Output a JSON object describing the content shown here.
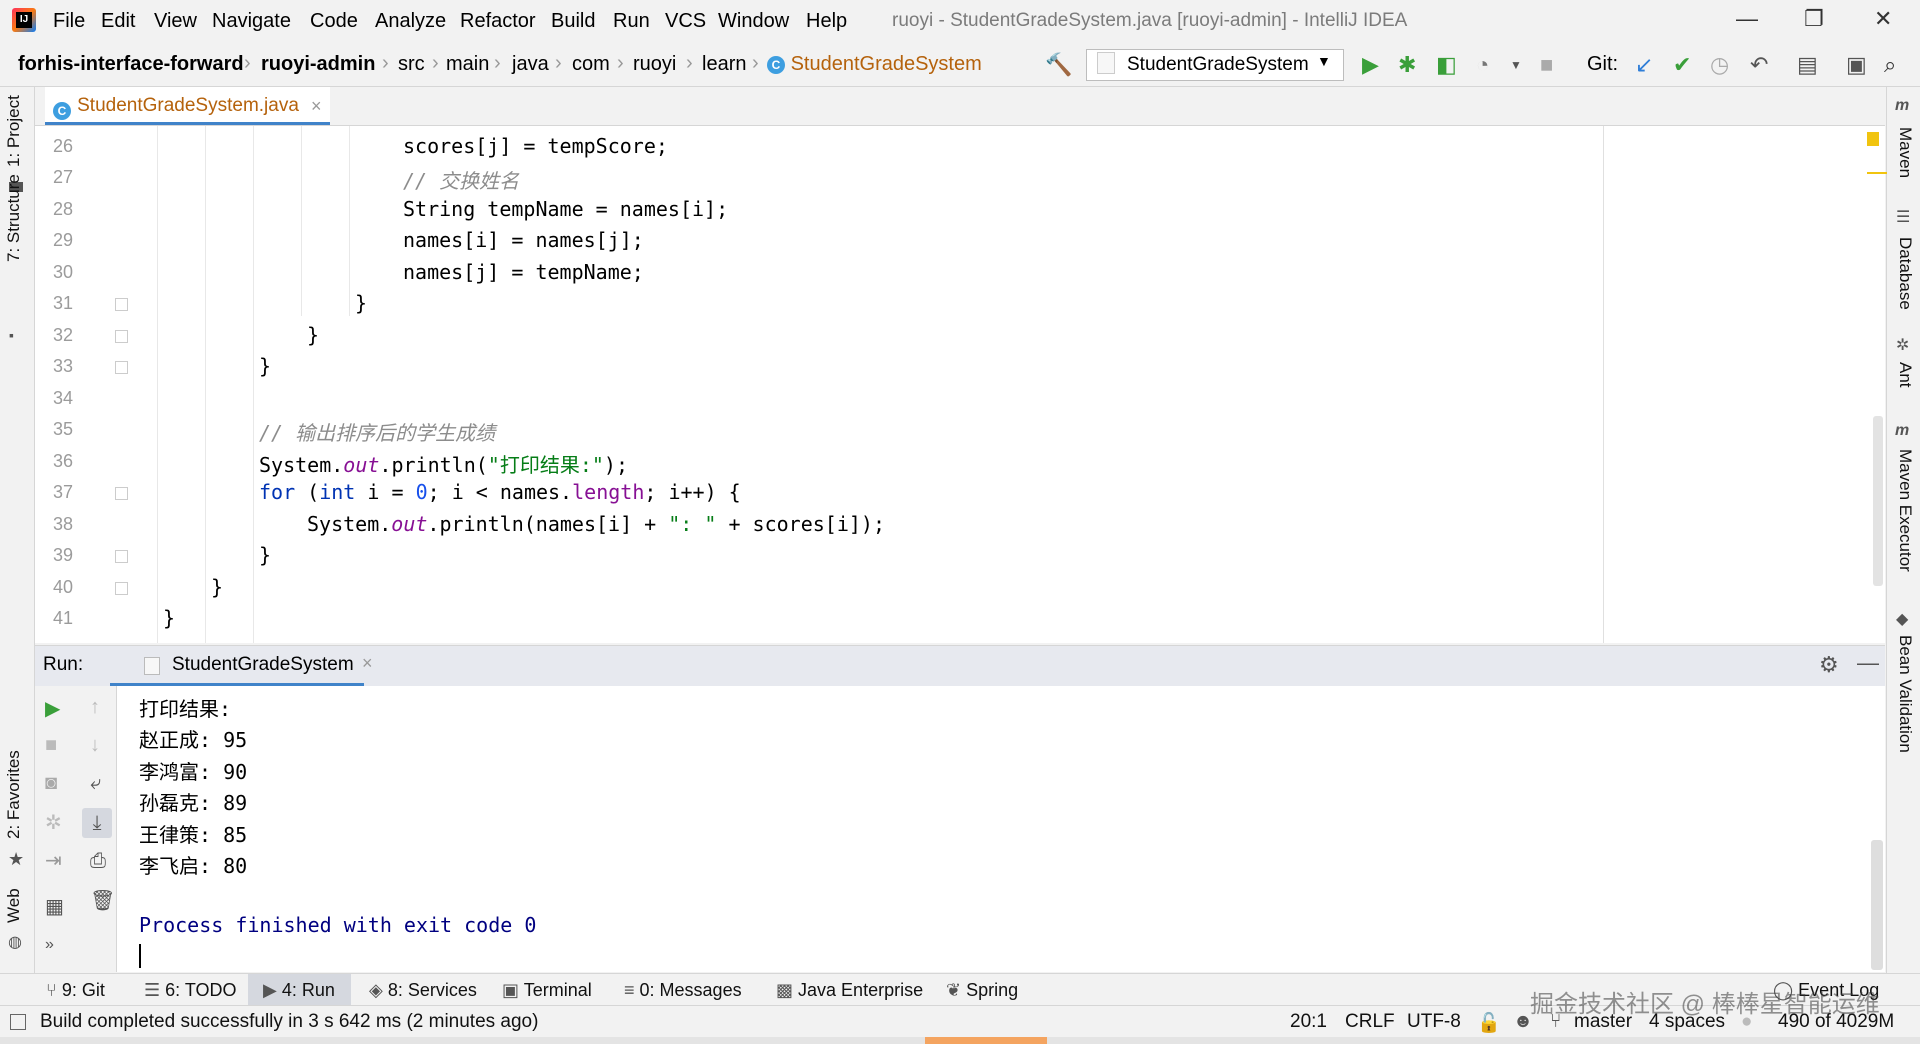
{
  "menubar": {
    "logo_text": "IJ",
    "items": [
      "File",
      "Edit",
      "View",
      "Navigate",
      "Code",
      "Analyze",
      "Refactor",
      "Build",
      "Run",
      "VCS",
      "Window",
      "Help"
    ],
    "window_title": "ruoyi - StudentGradeSystem.java [ruoyi-admin] - IntelliJ IDEA",
    "minimize": "—",
    "restore": "❐",
    "close": "✕"
  },
  "navbar": {
    "crumbs": [
      "forhis-interface-forward",
      "ruoyi-admin",
      "src",
      "main",
      "java",
      "com",
      "ruoyi",
      "learn",
      "StudentGradeSystem"
    ],
    "run_config": "StudentGradeSystem",
    "git_label": "Git:"
  },
  "left_strip": {
    "project": "1: Project",
    "structure": "7: Structure",
    "favorites": "2: Favorites",
    "web": "Web"
  },
  "right_strip": {
    "maven": "Maven",
    "database": "Database",
    "ant": "Ant",
    "maven_executor": "Maven Executor",
    "bean_validation": "Bean Validation"
  },
  "editor": {
    "tab_label": "StudentGradeSystem.java",
    "tab_close": "×",
    "line_numbers": [
      "26",
      "27",
      "28",
      "29",
      "30",
      "31",
      "32",
      "33",
      "34",
      "35",
      "36",
      "37",
      "38",
      "39",
      "40",
      "41"
    ],
    "code": {
      "l26": "scores[j] = tempScore;",
      "l27": "// 交换姓名",
      "l28": "String tempName = names[i];",
      "l29": "names[i] = names[j];",
      "l30": "names[j] = tempName;",
      "l31": "}",
      "l32": "}",
      "l33": "}",
      "l35": "// 输出排序后的学生成绩",
      "l36_a": "System.",
      "l36_b": "out",
      "l36_c": ".println(",
      "l36_d": "\"打印结果:\"",
      "l36_e": ");",
      "l37_for": "for",
      "l37_a": " (",
      "l37_int": "int",
      "l37_b": " i = ",
      "l37_zero": "0",
      "l37_c": "; i < names.",
      "l37_length": "length",
      "l37_d": "; i++) {",
      "l38_a": "System.",
      "l38_b": "out",
      "l38_c": ".println(names[i] + ",
      "l38_d": "\": \"",
      "l38_e": " + scores[i]);",
      "l39": "}",
      "l40": "}",
      "l41": "}"
    }
  },
  "run_panel": {
    "label": "Run:",
    "tab_label": "StudentGradeSystem",
    "tab_close": "×",
    "output": [
      "打印结果:",
      "赵正成: 95",
      "李鸿富: 90",
      "孙磊克: 89",
      "王律策: 85",
      "李飞启: 80",
      "",
      "Process finished with exit code 0"
    ]
  },
  "bottom_tabs": [
    "9: Git",
    "6: TODO",
    "4: Run",
    "8: Services",
    "Terminal",
    "0: Messages",
    "Java Enterprise",
    "Spring",
    "Event Log"
  ],
  "status": {
    "message": "Build completed successfully in 3 s 642 ms (2 minutes ago)",
    "position": "20:1",
    "line_sep": "CRLF",
    "encoding": "UTF-8",
    "branch": "master",
    "indent": "4 spaces",
    "memory": "490 of 4029M"
  },
  "watermark": "掘金技术社区 @ 棒棒星智能运维",
  "colors": {
    "accent": "#4083c9",
    "keyword": "#0033b3",
    "string": "#067d17",
    "field": "#871094",
    "comment": "#8c8c8c",
    "console_text": "#000080"
  }
}
